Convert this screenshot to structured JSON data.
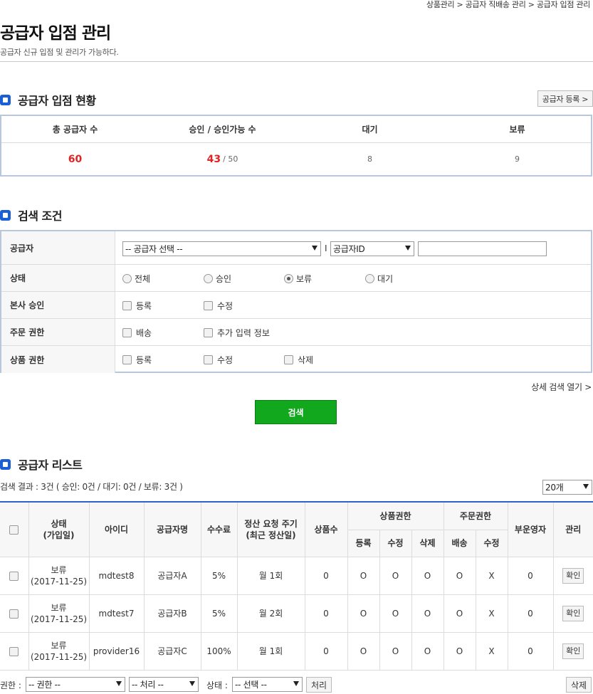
{
  "breadcrumb": "상품관리 > 공급자 직배송 관리 > 공급자 입점 관리",
  "page": {
    "title": "공급자 입점 관리",
    "description": "공급자 신규 입점 및 관리가 가능하다."
  },
  "status_section": {
    "title": "공급자 입점 현황",
    "register_button": "공급자 등록 >",
    "headers": [
      "총 공급자 수",
      "승인 / 승인가능 수",
      "대기",
      "보류"
    ],
    "total": "60",
    "approved": "43",
    "approved_limit": "/ 50",
    "waiting": "8",
    "hold": "9"
  },
  "search_section": {
    "title": "검색 조건",
    "supplier_label": "공급자",
    "supplier_select": "-- 공급자 선택 --",
    "divider": "I",
    "id_select": "공급자ID",
    "search_value": "",
    "status_label": "상태",
    "status_options": [
      "전체",
      "승인",
      "보류",
      "대기"
    ],
    "status_selected": "보류",
    "hq_label": "본사 승인",
    "hq_options": [
      "등록",
      "수정"
    ],
    "order_label": "주문 권한",
    "order_options": [
      "배송",
      "추가 입력 정보"
    ],
    "product_label": "상품 권한",
    "product_options": [
      "등록",
      "수정",
      "삭제"
    ],
    "advanced_link": "상세 검색 열기 >",
    "search_button": "검색"
  },
  "list_section": {
    "title": "공급자 리스트",
    "result_summary": "검색 결과 : 3건 ( 승인: 0건 / 대기: 0건 / 보류: 3건 )",
    "page_size": "20개",
    "headers": {
      "status_line1": "상태",
      "status_line2": "(가입일)",
      "id": "아이디",
      "name": "공급자명",
      "fee": "수수료",
      "settle_line1": "정산 요청 주기",
      "settle_line2": "(최근 정산일)",
      "product_count": "상품수",
      "product_perm": "상품권한",
      "order_perm": "주문권한",
      "sub_operator": "부운영자",
      "manage": "관리",
      "sub_register": "등록",
      "sub_modify": "수정",
      "sub_delete": "삭제",
      "sub_ship": "배송",
      "sub_order_modify": "수정"
    },
    "rows": [
      {
        "status": "보류",
        "date": "(2017-11-25)",
        "id": "mdtest8",
        "name": "공급자A",
        "fee": "5%",
        "settle": "월 1회",
        "count": "0",
        "p_reg": "O",
        "p_mod": "O",
        "p_del": "O",
        "o_ship": "O",
        "o_mod": "X",
        "sub": "0",
        "action": "확인"
      },
      {
        "status": "보류",
        "date": "(2017-11-25)",
        "id": "mdtest7",
        "name": "공급자B",
        "fee": "5%",
        "settle": "월 2회",
        "count": "0",
        "p_reg": "O",
        "p_mod": "O",
        "p_del": "O",
        "o_ship": "O",
        "o_mod": "X",
        "sub": "0",
        "action": "확인"
      },
      {
        "status": "보류",
        "date": "(2017-11-25)",
        "id": "provider16",
        "name": "공급자C",
        "fee": "100%",
        "settle": "월 1회",
        "count": "0",
        "p_reg": "O",
        "p_mod": "O",
        "p_del": "O",
        "o_ship": "O",
        "o_mod": "X",
        "sub": "0",
        "action": "확인"
      }
    ]
  },
  "bottom_bar": {
    "perm_label": "권한 :",
    "perm_select": "-- 권한 --",
    "process_select": "-- 처리 --",
    "status_label": "상태 :",
    "status_select": "-- 선택 --",
    "process_button": "처리",
    "delete_button": "삭제"
  },
  "colors": {
    "accent_blue": "#1a5fd6",
    "highlight_red": "#e02323",
    "search_green": "#12a81e"
  }
}
